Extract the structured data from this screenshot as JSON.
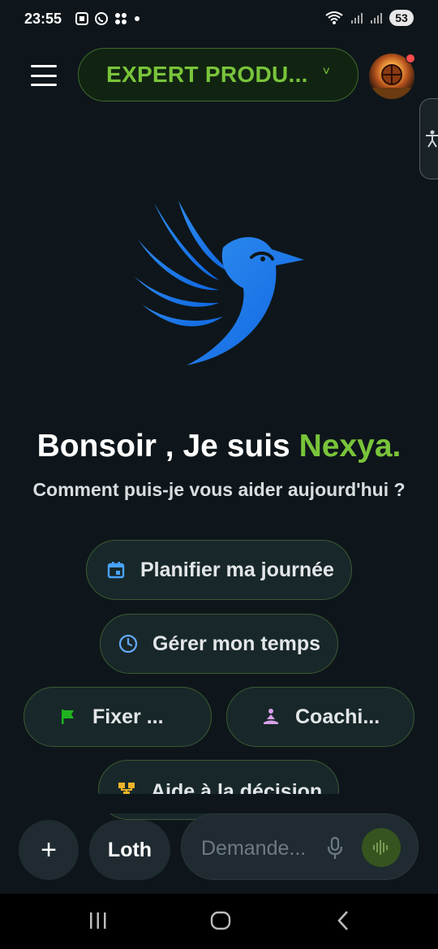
{
  "status_bar": {
    "time": "23:55",
    "battery": "53",
    "icons": [
      "screenshot-icon",
      "whatsapp-icon",
      "apps-icon",
      "dot-icon",
      "wifi-icon",
      "signal-icon",
      "signal-icon"
    ]
  },
  "header": {
    "model_label": "EXPERT PRODU...",
    "chevron": "˅",
    "accent_color": "#79c43a"
  },
  "greeting": {
    "line1_prefix": "Bonsoir , Je suis ",
    "assistant_name": "Nexya.",
    "subtitle": "Comment puis-je vous aider aujourd'hui ?"
  },
  "suggestions": [
    {
      "label": "Planifier ma journée",
      "icon": "calendar-icon",
      "icon_color": "#4aa3ff"
    },
    {
      "label": "Gérer mon temps",
      "icon": "clock-icon",
      "icon_color": "#66a9ff"
    },
    {
      "label": "Fixer ...",
      "icon": "flag-icon",
      "icon_color": "#1fb41f"
    },
    {
      "label": "Coachi...",
      "icon": "meditation-icon",
      "icon_color": "#d9a0e8"
    },
    {
      "label": "Aide à la décision",
      "icon": "decision-tree-icon",
      "icon_color": "#f0b429"
    }
  ],
  "composer": {
    "plus_label": "+",
    "mode_label": "Loth",
    "placeholder": "Demande..."
  }
}
